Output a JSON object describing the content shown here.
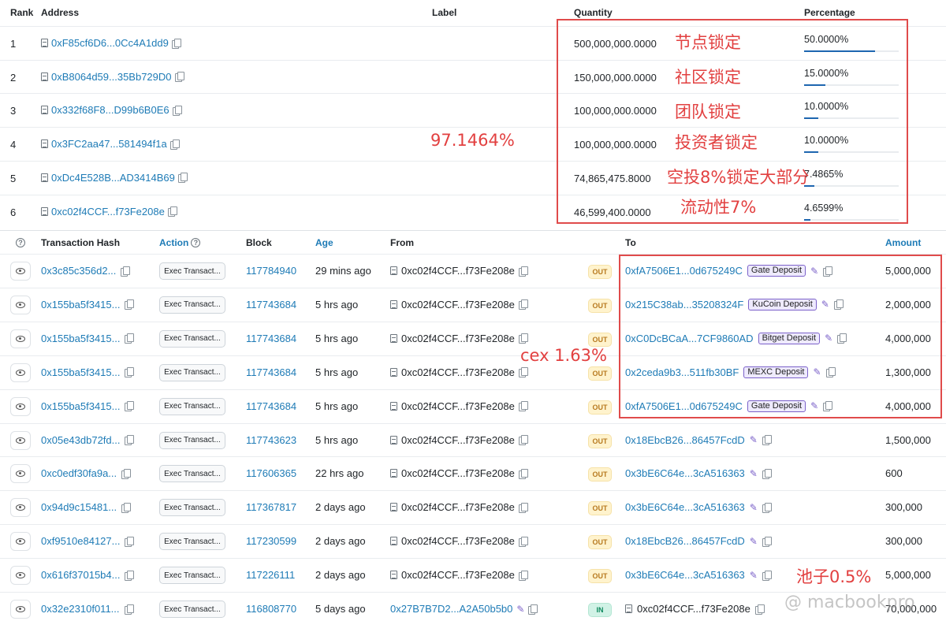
{
  "holders": {
    "headers": {
      "rank": "Rank",
      "address": "Address",
      "label": "Label",
      "quantity": "Quantity",
      "percentage": "Percentage"
    },
    "rows": [
      {
        "rank": "1",
        "address": "0xF85cf6D6...0Cc4A1dd9",
        "quantity": "500,000,000.0000",
        "percentage": "50.0000%",
        "pct_value": 50.0
      },
      {
        "rank": "2",
        "address": "0xB8064d59...35Bb729D0",
        "quantity": "150,000,000.0000",
        "percentage": "15.0000%",
        "pct_value": 15.0
      },
      {
        "rank": "3",
        "address": "0x332f68F8...D99b6B0E6",
        "quantity": "100,000,000.0000",
        "percentage": "10.0000%",
        "pct_value": 10.0
      },
      {
        "rank": "4",
        "address": "0x3FC2aa47...581494f1a",
        "quantity": "100,000,000.0000",
        "percentage": "10.0000%",
        "pct_value": 10.0
      },
      {
        "rank": "5",
        "address": "0xDc4E528B...AD3414B69",
        "quantity": "74,865,475.8000",
        "percentage": "7.4865%",
        "pct_value": 7.4865
      },
      {
        "rank": "6",
        "address": "0xc02f4CCF...f73Fe208e",
        "quantity": "46,599,400.0000",
        "percentage": "4.6599%",
        "pct_value": 4.6599
      }
    ]
  },
  "transactions": {
    "headers": {
      "hash": "Transaction Hash",
      "action": "Action",
      "block": "Block",
      "age": "Age",
      "from": "From",
      "to": "To",
      "amount": "Amount"
    },
    "rows": [
      {
        "hash": "0x3c85c356d2...",
        "action": "Exec Transact...",
        "block": "117784940",
        "age": "29 mins ago",
        "from": "0xc02f4CCF...f73Fe208e",
        "dir": "OUT",
        "to": "0xfA7506E1...0d675249C",
        "tag": "Gate Deposit",
        "amount": "5,000,000"
      },
      {
        "hash": "0x155ba5f3415...",
        "action": "Exec Transact...",
        "block": "117743684",
        "age": "5 hrs ago",
        "from": "0xc02f4CCF...f73Fe208e",
        "dir": "OUT",
        "to": "0x215C38ab...35208324F",
        "tag": "KuCoin Deposit",
        "amount": "2,000,000"
      },
      {
        "hash": "0x155ba5f3415...",
        "action": "Exec Transact...",
        "block": "117743684",
        "age": "5 hrs ago",
        "from": "0xc02f4CCF...f73Fe208e",
        "dir": "OUT",
        "to": "0xC0DcBCaA...7CF9860AD",
        "tag": "Bitget Deposit",
        "amount": "4,000,000"
      },
      {
        "hash": "0x155ba5f3415...",
        "action": "Exec Transact...",
        "block": "117743684",
        "age": "5 hrs ago",
        "from": "0xc02f4CCF...f73Fe208e",
        "dir": "OUT",
        "to": "0x2ceda9b3...511fb30BF",
        "tag": "MEXC Deposit",
        "amount": "1,300,000"
      },
      {
        "hash": "0x155ba5f3415...",
        "action": "Exec Transact...",
        "block": "117743684",
        "age": "5 hrs ago",
        "from": "0xc02f4CCF...f73Fe208e",
        "dir": "OUT",
        "to": "0xfA7506E1...0d675249C",
        "tag": "Gate Deposit",
        "amount": "4,000,000"
      },
      {
        "hash": "0x05e43db72fd...",
        "action": "Exec Transact...",
        "block": "117743623",
        "age": "5 hrs ago",
        "from": "0xc02f4CCF...f73Fe208e",
        "dir": "OUT",
        "to": "0x18EbcB26...86457FcdD",
        "tag": "",
        "amount": "1,500,000"
      },
      {
        "hash": "0xc0edf30fa9a...",
        "action": "Exec Transact...",
        "block": "117606365",
        "age": "22 hrs ago",
        "from": "0xc02f4CCF...f73Fe208e",
        "dir": "OUT",
        "to": "0x3bE6C64e...3cA516363",
        "tag": "",
        "amount": "600"
      },
      {
        "hash": "0x94d9c15481...",
        "action": "Exec Transact...",
        "block": "117367817",
        "age": "2 days ago",
        "from": "0xc02f4CCF...f73Fe208e",
        "dir": "OUT",
        "to": "0x3bE6C64e...3cA516363",
        "tag": "",
        "amount": "300,000"
      },
      {
        "hash": "0xf9510e84127...",
        "action": "Exec Transact...",
        "block": "117230599",
        "age": "2 days ago",
        "from": "0xc02f4CCF...f73Fe208e",
        "dir": "OUT",
        "to": "0x18EbcB26...86457FcdD",
        "tag": "",
        "amount": "300,000"
      },
      {
        "hash": "0x616f37015b4...",
        "action": "Exec Transact...",
        "block": "117226111",
        "age": "2 days ago",
        "from": "0xc02f4CCF...f73Fe208e",
        "dir": "OUT",
        "to": "0x3bE6C64e...3cA516363",
        "tag": "",
        "amount": "5,000,000"
      },
      {
        "hash": "0x32e2310f011...",
        "action": "Exec Transact...",
        "block": "116808770",
        "age": "5 days ago",
        "from": "0x27B7B7D2...A2A50b5b0",
        "dir": "IN",
        "to": "0xc02f4CCF...f73Fe208e",
        "tag": "",
        "amount": "70,000,000"
      }
    ]
  },
  "annotations": {
    "holder_labels": [
      "节点锁定",
      "社区锁定",
      "团队锁定",
      "投资者锁定",
      "空投8%锁定大部分",
      "流动性7%"
    ],
    "total": "97.1464%",
    "cex": "cex 1.63%",
    "pool": "池子0.5%"
  },
  "watermark": "@ macbookpro",
  "colors": {
    "link": "#1e7bb6",
    "annotation": "#e24040",
    "tag_border": "#7b61c9",
    "out_badge": "#fff3cd",
    "in_badge": "#d1f2e6"
  }
}
